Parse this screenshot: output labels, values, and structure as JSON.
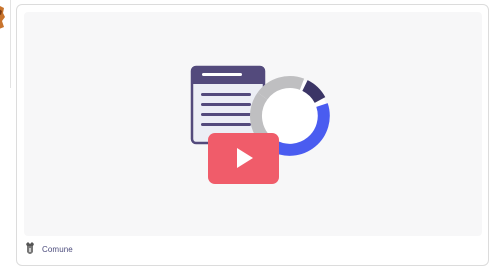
{
  "card": {
    "media_icons": [
      "document-icon",
      "donut-chart-icon",
      "video-play-icon"
    ],
    "author": {
      "name": "Comune",
      "avatar_icon": "coat-of-arms-icon"
    }
  },
  "colors": {
    "document_header": "#534a7c",
    "document_body": "#eceef5",
    "donut_primary": "#4a5cf0",
    "donut_secondary": "#bfbfc1",
    "donut_dark": "#3b3566",
    "video_red": "#f05c6a",
    "media_bg": "#f7f7f8"
  }
}
